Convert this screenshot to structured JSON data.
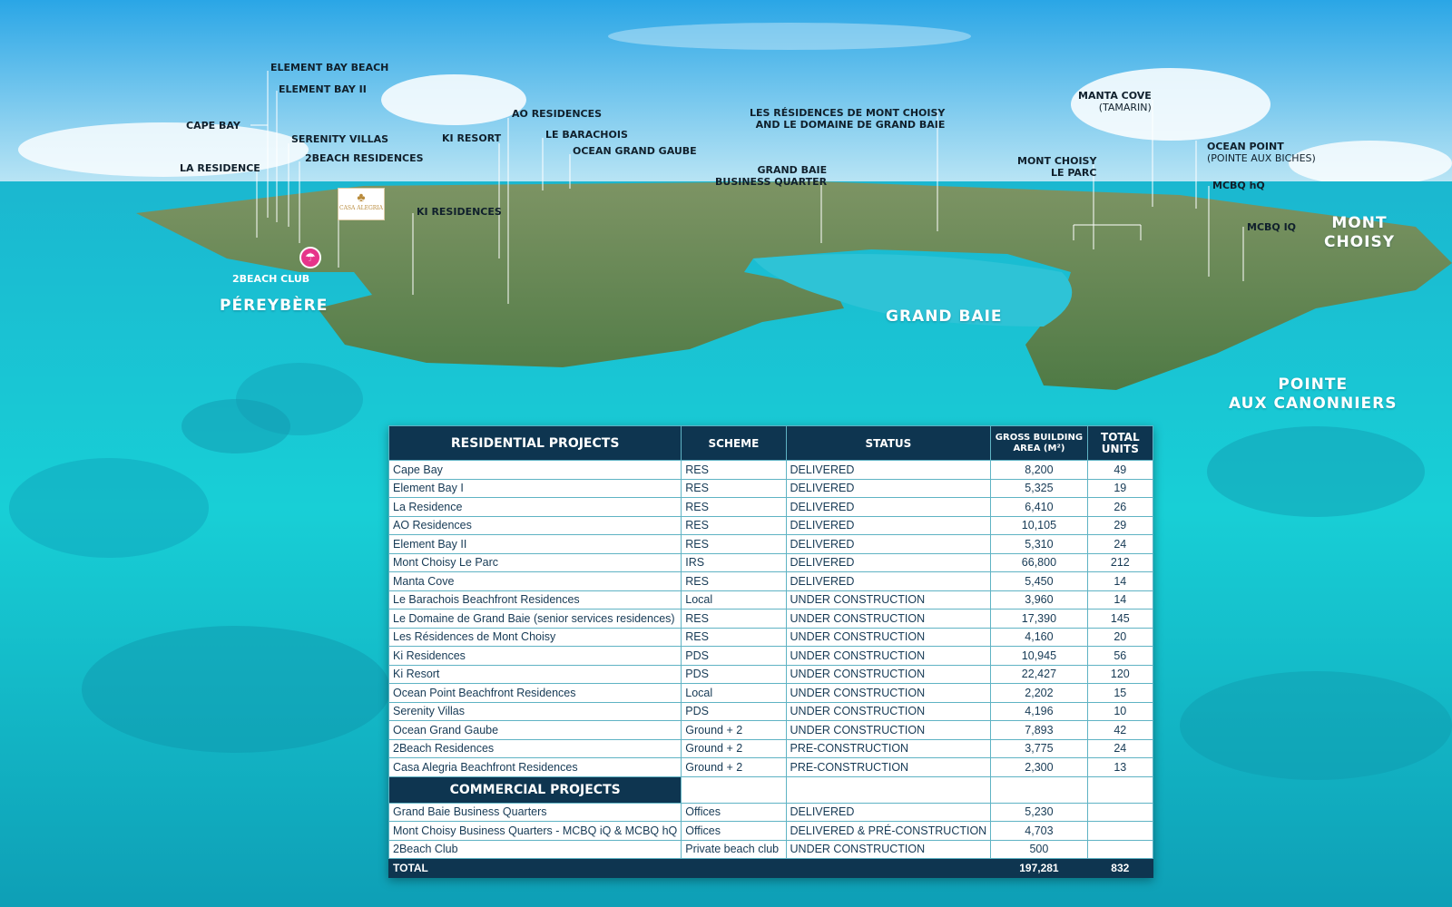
{
  "areas": {
    "pereybere": "PÉREYBÈRE",
    "grand_baie": "GRAND BAIE",
    "mont_choisy": "MONT CHOISY",
    "pointe_line1": "POINTE",
    "pointe_line2": "AUX CANONNIERS"
  },
  "labels": {
    "element_bay_beach": "ELEMENT BAY BEACH",
    "element_bay_ii": "ELEMENT BAY II",
    "cape_bay": "CAPE BAY",
    "serenity_villas": "SERENITY VILLAS",
    "two_beach_residences": "2BEACH RESIDENCES",
    "la_residence": "LA RESIDENCE",
    "ki_resort": "KI RESORT",
    "ao_residences": "AO RESIDENCES",
    "le_barachois": "LE BARACHOIS",
    "ocean_grand_gaube": "OCEAN GRAND GAUBE",
    "ki_residences": "KI RESIDENCES",
    "two_beach_club": "2BEACH CLUB",
    "mont_choisy_domaine_line1": "LES RÉSIDENCES DE MONT CHOISY",
    "mont_choisy_domaine_line2": "AND LE DOMAINE DE GRAND BAIE",
    "gbbq_line1": "GRAND BAIE",
    "gbbq_line2": "BUSINESS QUARTER",
    "manta_cove": "MANTA COVE",
    "manta_cove_sub": "(TAMARIN)",
    "mont_choisy_le_parc_line1": "MONT CHOISY",
    "mont_choisy_le_parc_line2": "LE PARC",
    "ocean_point": "OCEAN POINT",
    "ocean_point_sub": "(POINTE AUX BICHES)",
    "mcbq_hq": "MCBQ hQ",
    "mcbq_iq": "MCBQ IQ"
  },
  "logo": {
    "casa_alegria": "CASA ALEGRIA"
  },
  "icons": {
    "beach_club": "beach-umbrella-icon",
    "logo": "palm-tree-icon"
  },
  "colors": {
    "header_navy": "#0e3550",
    "pin_pink": "#e6348a",
    "table_text": "#163a55",
    "grid_line": "#5fb3c4"
  },
  "table": {
    "headers": {
      "residential": "RESIDENTIAL PROJECTS",
      "scheme": "SCHEME",
      "status": "STATUS",
      "gba_line1": "GROSS BUILDING",
      "gba_line2": "AREA (M²)",
      "units_line1": "TOTAL",
      "units_line2": "UNITS"
    },
    "residential": [
      {
        "name": "Cape Bay",
        "scheme": "RES",
        "status": "DELIVERED",
        "area": "8,200",
        "units": "49"
      },
      {
        "name": "Element Bay I",
        "scheme": "RES",
        "status": "DELIVERED",
        "area": "5,325",
        "units": "19"
      },
      {
        "name": "La Residence",
        "scheme": "RES",
        "status": "DELIVERED",
        "area": "6,410",
        "units": "26"
      },
      {
        "name": "AO Residences",
        "scheme": "RES",
        "status": "DELIVERED",
        "area": "10,105",
        "units": "29"
      },
      {
        "name": "Element Bay II",
        "scheme": "RES",
        "status": "DELIVERED",
        "area": "5,310",
        "units": "24"
      },
      {
        "name": "Mont Choisy Le Parc",
        "scheme": "IRS",
        "status": "DELIVERED",
        "area": "66,800",
        "units": "212"
      },
      {
        "name": "Manta Cove",
        "scheme": "RES",
        "status": "DELIVERED",
        "area": "5,450",
        "units": "14"
      },
      {
        "name": "Le Barachois Beachfront Residences",
        "scheme": "Local",
        "status": "UNDER CONSTRUCTION",
        "area": "3,960",
        "units": "14"
      },
      {
        "name": "Le Domaine de Grand Baie (senior services residences)",
        "scheme": "RES",
        "status": "UNDER CONSTRUCTION",
        "area": "17,390",
        "units": "145"
      },
      {
        "name": "Les Résidences de Mont Choisy",
        "scheme": "RES",
        "status": "UNDER CONSTRUCTION",
        "area": "4,160",
        "units": "20"
      },
      {
        "name": "Ki Residences",
        "scheme": "PDS",
        "status": "UNDER CONSTRUCTION",
        "area": "10,945",
        "units": "56"
      },
      {
        "name": "Ki Resort",
        "scheme": "PDS",
        "status": "UNDER CONSTRUCTION",
        "area": "22,427",
        "units": "120"
      },
      {
        "name": "Ocean Point Beachfront Residences",
        "scheme": "Local",
        "status": "UNDER CONSTRUCTION",
        "area": "2,202",
        "units": "15"
      },
      {
        "name": "Serenity Villas",
        "scheme": "PDS",
        "status": "UNDER CONSTRUCTION",
        "area": "4,196",
        "units": "10"
      },
      {
        "name": "Ocean Grand Gaube",
        "scheme": "Ground + 2",
        "status": "UNDER CONSTRUCTION",
        "area": "7,893",
        "units": "42"
      },
      {
        "name": "2Beach Residences",
        "scheme": "Ground + 2",
        "status": "PRE-CONSTRUCTION",
        "area": "3,775",
        "units": "24"
      },
      {
        "name": "Casa Alegria Beachfront Residences",
        "scheme": "Ground + 2",
        "status": "PRE-CONSTRUCTION",
        "area": "2,300",
        "units": "13"
      }
    ],
    "commercial_title": "COMMERCIAL PROJECTS",
    "commercial": [
      {
        "name": "Grand Baie Business Quarters",
        "scheme": "Offices",
        "status": "DELIVERED",
        "area": "5,230",
        "units": ""
      },
      {
        "name": "Mont Choisy Business Quarters - MCBQ iQ & MCBQ hQ",
        "scheme": "Offices",
        "status": "DELIVERED & PRÉ-CONSTRUCTION",
        "area": "4,703",
        "units": ""
      },
      {
        "name": "2Beach Club",
        "scheme": "Private beach club",
        "status": "UNDER CONSTRUCTION",
        "area": "500",
        "units": ""
      }
    ],
    "total": {
      "label": "TOTAL",
      "area": "197,281",
      "units": "832"
    }
  }
}
